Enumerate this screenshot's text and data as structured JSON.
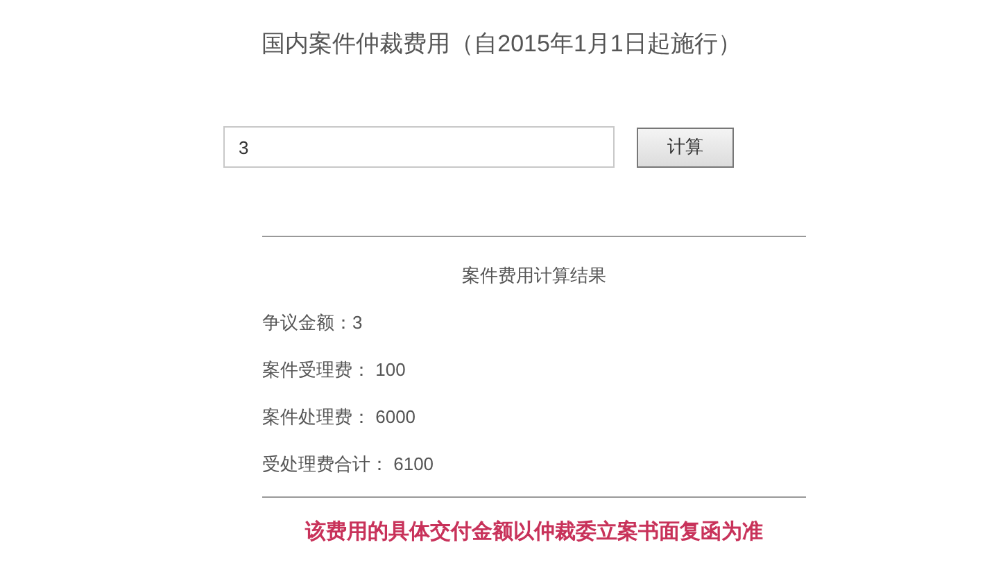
{
  "title": "国内案件仲裁费用（自2015年1月1日起施行）",
  "amount_field": {
    "value": "3"
  },
  "calculate_button": "计算",
  "result": {
    "heading": "案件费用计算结果",
    "rows": [
      "争议金额：3",
      "案件受理费： 100",
      "案件处理费： 6000",
      "受处理费合计： 6100"
    ]
  },
  "note": "该费用的具体交付金额以仲裁委立案书面复函为准"
}
